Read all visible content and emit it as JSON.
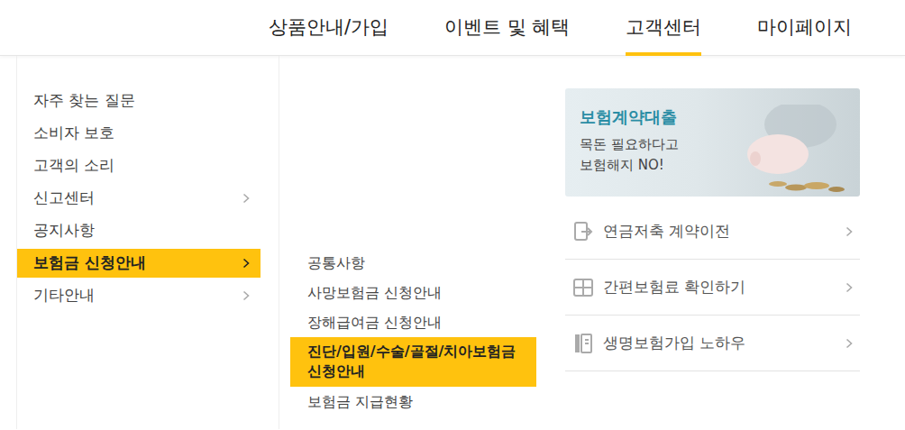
{
  "nav": {
    "items": [
      {
        "label": "상품안내/가입",
        "selected": false
      },
      {
        "label": "이벤트 및 혜택",
        "selected": false
      },
      {
        "label": "고객센터",
        "selected": true
      },
      {
        "label": "마이페이지",
        "selected": false
      }
    ]
  },
  "sidebar": {
    "items": [
      {
        "label": "자주 찾는 질문",
        "selected": false,
        "has_submenu": false
      },
      {
        "label": "소비자 보호",
        "selected": false,
        "has_submenu": false
      },
      {
        "label": "고객의 소리",
        "selected": false,
        "has_submenu": false
      },
      {
        "label": "신고센터",
        "selected": false,
        "has_submenu": true
      },
      {
        "label": "공지사항",
        "selected": false,
        "has_submenu": false
      },
      {
        "label": "보험금 신청안내",
        "selected": true,
        "has_submenu": true
      },
      {
        "label": "기타안내",
        "selected": false,
        "has_submenu": true
      }
    ]
  },
  "submenu": {
    "items": [
      {
        "label": "공통사항",
        "selected": false
      },
      {
        "label": "사망보험금 신청안내",
        "selected": false
      },
      {
        "label": "장해급여금 신청안내",
        "selected": false
      },
      {
        "label": "진단/입원/수술/골절/치아보험금 신청안내",
        "selected": true
      },
      {
        "label": "보험금 지급현황",
        "selected": false
      }
    ]
  },
  "banner": {
    "title": "보험계약대출",
    "lines": [
      "목돈 필요하다고",
      "보험해지 NO!"
    ]
  },
  "quick_links": [
    {
      "label": "연금저축 계약이전",
      "kind": "transfer"
    },
    {
      "label": "간편보험료 확인하기",
      "kind": "calculator"
    },
    {
      "label": "생명보험가입 노하우",
      "kind": "guide"
    }
  ]
}
